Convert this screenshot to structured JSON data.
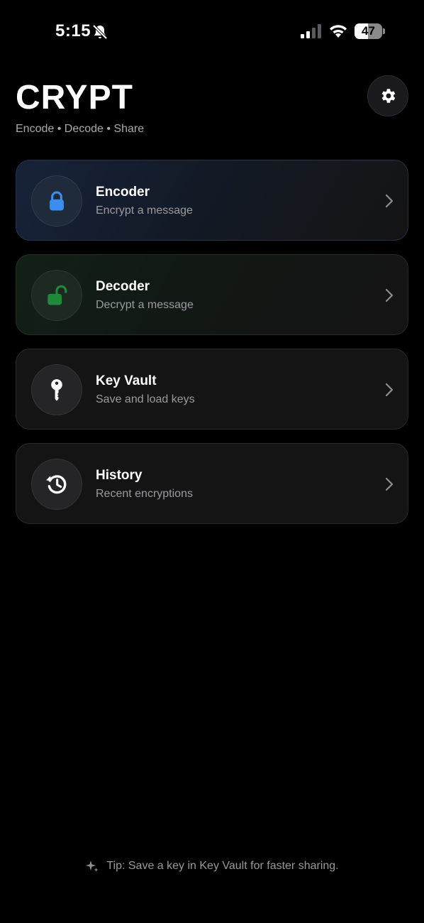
{
  "status_bar": {
    "time": "5:15",
    "battery": "47",
    "icons": [
      "bell-slash-icon",
      "signal-icon",
      "wifi-icon",
      "battery-icon"
    ]
  },
  "header": {
    "title": "CRYPT",
    "subtitle": "Encode • Decode • Share",
    "settings_icon": "gear-icon"
  },
  "menu": [
    {
      "title": "Encoder",
      "subtitle": "Encrypt a message",
      "icon": "lock-icon",
      "accent": "#3b8df0"
    },
    {
      "title": "Decoder",
      "subtitle": "Decrypt a message",
      "icon": "unlock-icon",
      "accent": "#1f8a3a"
    },
    {
      "title": "Key Vault",
      "subtitle": "Save and load keys",
      "icon": "key-icon",
      "accent": "#ffffff"
    },
    {
      "title": "History",
      "subtitle": "Recent encryptions",
      "icon": "history-icon",
      "accent": "#ffffff"
    }
  ],
  "tip": {
    "icon": "sparkle-icon",
    "text": "Tip: Save a key in Key Vault for faster sharing."
  }
}
